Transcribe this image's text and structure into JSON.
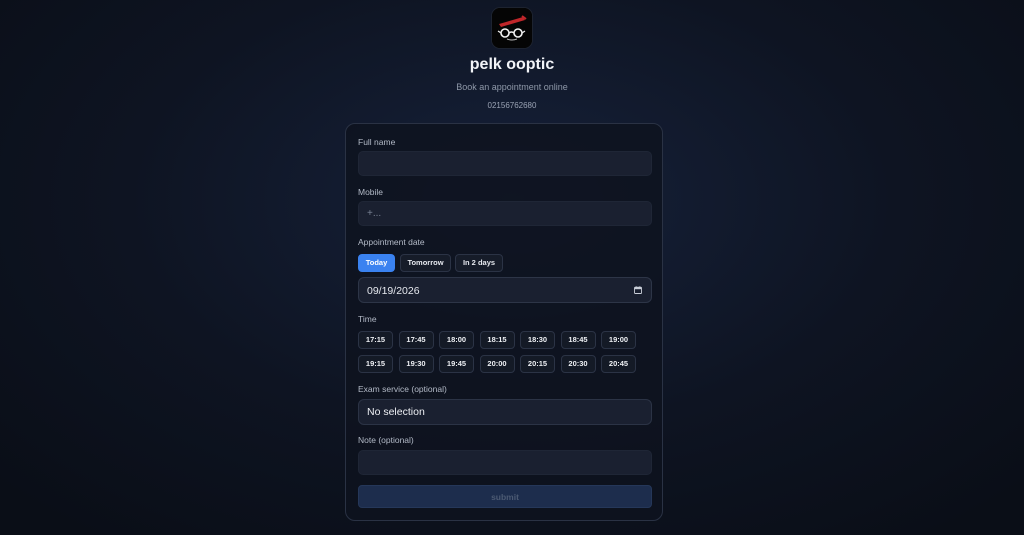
{
  "brand": {
    "logo": "pelk-ooptic-logo",
    "name": "pelk ooptic",
    "tagline": "Book an appointment online",
    "phone": "02156762680"
  },
  "form": {
    "full_name": {
      "label": "Full name",
      "value": "",
      "placeholder": ""
    },
    "mobile": {
      "label": "Mobile",
      "value": "",
      "placeholder": "+..."
    },
    "date": {
      "label": "Appointment date",
      "quick_options": [
        "Today",
        "Tomorrow",
        "In 2 days"
      ],
      "selected_quick": "Today",
      "value": "09/19/2026",
      "icon": "calendar-icon"
    },
    "time": {
      "label": "Time",
      "slots": [
        "17:15",
        "17:45",
        "18:00",
        "18:15",
        "18:30",
        "18:45",
        "19:00",
        "19:15",
        "19:30",
        "19:45",
        "20:00",
        "20:15",
        "20:30",
        "20:45"
      ]
    },
    "service": {
      "label": "Exam service (optional)",
      "value": "No selection"
    },
    "note": {
      "label": "Note (optional)",
      "value": "",
      "placeholder": ""
    },
    "submit_label": "submit"
  },
  "colors": {
    "accent": "#3a82f0",
    "background": "#0e1422",
    "card_border": "#2a3244",
    "submit_disabled": "#1d2d4d"
  }
}
